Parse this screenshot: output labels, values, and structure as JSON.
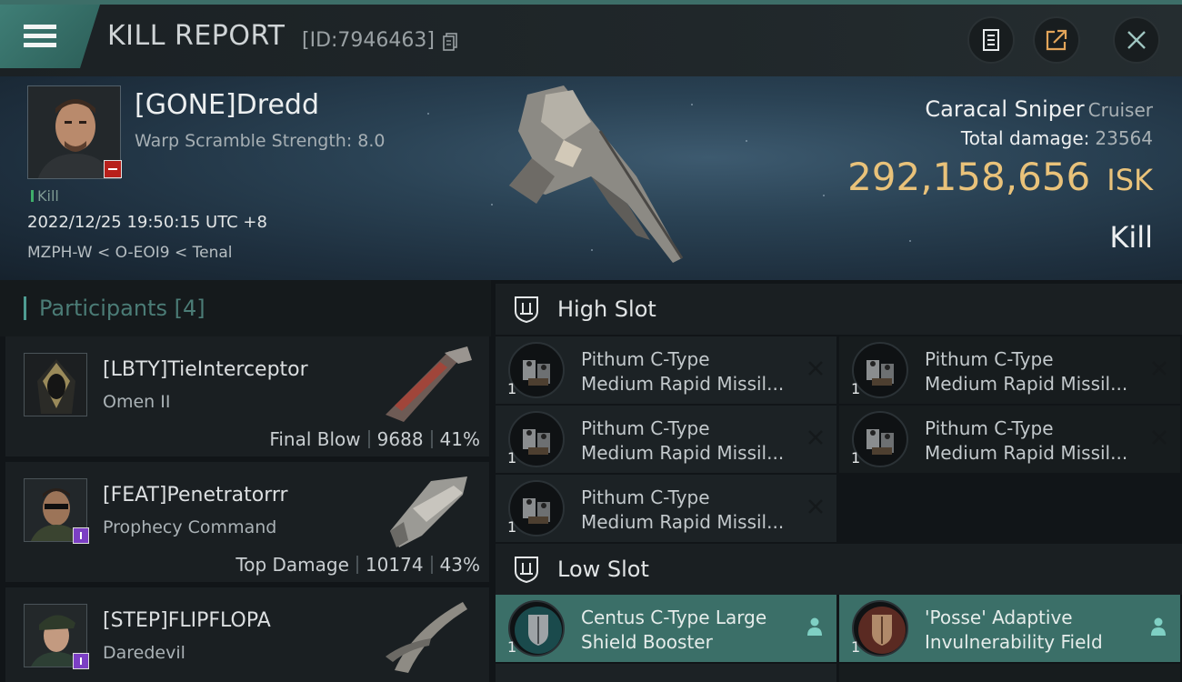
{
  "header": {
    "title": "KILL REPORT",
    "kill_id": "[ID:7946463]"
  },
  "victim": {
    "name": "[GONE]Dredd",
    "warp_scramble": "Warp Scramble Strength: 8.0",
    "tag": "Kill",
    "datetime": "2022/12/25 19:50:15 UTC +8",
    "location": "MZPH-W < O-EOI9 < Tenal",
    "ship_name": "Caracal Sniper",
    "ship_class": "Cruiser",
    "damage_label": "Total damage:",
    "damage_value": "23564",
    "isk_value": "292,158,656",
    "isk_unit": "ISK",
    "result": "Kill"
  },
  "participants": {
    "title": "Participants",
    "count": "[4]",
    "rows": [
      {
        "name": "[LBTY]TieInterceptor",
        "ship": "Omen II",
        "role": "Final Blow",
        "damage": "9688",
        "percent": "41%"
      },
      {
        "name": "[FEAT]Penetratorrr",
        "ship": "Prophecy Command",
        "role": "Top Damage",
        "damage": "10174",
        "percent": "43%"
      },
      {
        "name": "[STEP]FLIPFLOPA",
        "ship": "Daredevil",
        "role": "",
        "damage": "",
        "percent": ""
      }
    ]
  },
  "slots": {
    "high": {
      "title": "High Slot",
      "modules": [
        {
          "qty": "1",
          "line1": "Pithum C-Type",
          "line2": "Medium Rapid Missil..."
        },
        {
          "qty": "1",
          "line1": "Pithum C-Type",
          "line2": "Medium Rapid Missil..."
        },
        {
          "qty": "1",
          "line1": "Pithum C-Type",
          "line2": "Medium Rapid Missil..."
        },
        {
          "qty": "1",
          "line1": "Pithum C-Type",
          "line2": "Medium Rapid Missil..."
        },
        {
          "qty": "1",
          "line1": "Pithum C-Type",
          "line2": "Medium Rapid Missil..."
        }
      ]
    },
    "low": {
      "title": "Low Slot",
      "modules": [
        {
          "qty": "1",
          "line1": "Centus C-Type Large",
          "line2": "Shield Booster"
        },
        {
          "qty": "1",
          "line1": "'Posse' Adaptive",
          "line2": "Invulnerability Field"
        }
      ]
    }
  },
  "colors": {
    "accent_teal": "#3b6f68",
    "isk_gold": "#e9c27a",
    "loss_red": "#b8201b",
    "badge_purple": "#7c3fc4"
  },
  "icons": [
    "menu-icon",
    "copy-icon",
    "clipboard-icon",
    "share-icon",
    "close-icon",
    "shield-slot-icon",
    "remove-icon",
    "user-icon"
  ]
}
